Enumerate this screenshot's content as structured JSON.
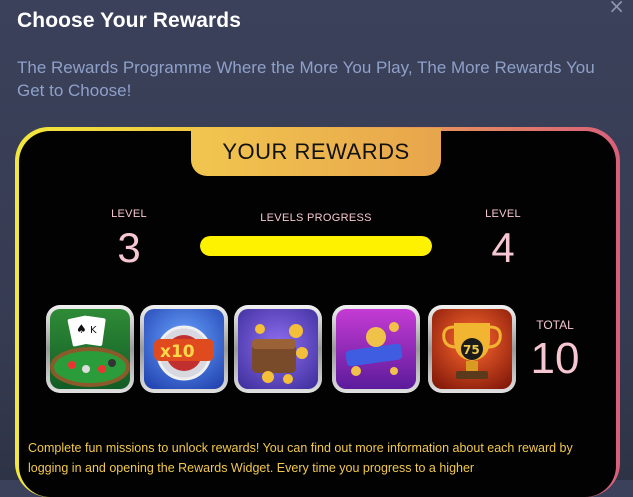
{
  "modal": {
    "title": "Choose Your Rewards",
    "subtitle": "The Rewards Programme Where the More You Play, The More Rewards You Get to Choose!",
    "close_icon": "close-icon"
  },
  "rewards": {
    "tab_label": "YOUR REWARDS",
    "current_level_label": "LEVEL",
    "current_level": "3",
    "next_level_label": "LEVEL",
    "next_level": "4",
    "progress_label": "LEVELS PROGRESS",
    "progress_fraction": 1.0,
    "total_label": "TOTAL",
    "total": "10",
    "items": [
      {
        "name": "blackjack-table-reward",
        "icon": "blackjack-icon",
        "colors": [
          "#3c8f3c",
          "#155b27"
        ]
      },
      {
        "name": "multiplier-x10-reward",
        "icon": "x10-multiplier-icon",
        "colors": [
          "#3a72e6",
          "#1b3da8"
        ]
      },
      {
        "name": "wallet-coins-reward",
        "icon": "wallet-icon",
        "colors": [
          "#7b4ed8",
          "#3e2b9c"
        ]
      },
      {
        "name": "gaming-pad-coins-reward",
        "icon": "gamepad-coin-icon",
        "colors": [
          "#c23ad1",
          "#6b1fa4"
        ]
      },
      {
        "name": "trophy-75-reward",
        "icon": "trophy-icon",
        "colors": [
          "#e03a1f",
          "#7a1208"
        ]
      }
    ],
    "description": "Complete fun missions to unlock rewards! You can find out more information about each reward by logging in and opening the Rewards Widget. Every time you progress to a higher"
  },
  "colors": {
    "background": "#3b415a",
    "card": "#020202",
    "accent_yellow": "#fff200",
    "pink_text": "#f6c7d2",
    "gold_text": "#f2c94c"
  }
}
